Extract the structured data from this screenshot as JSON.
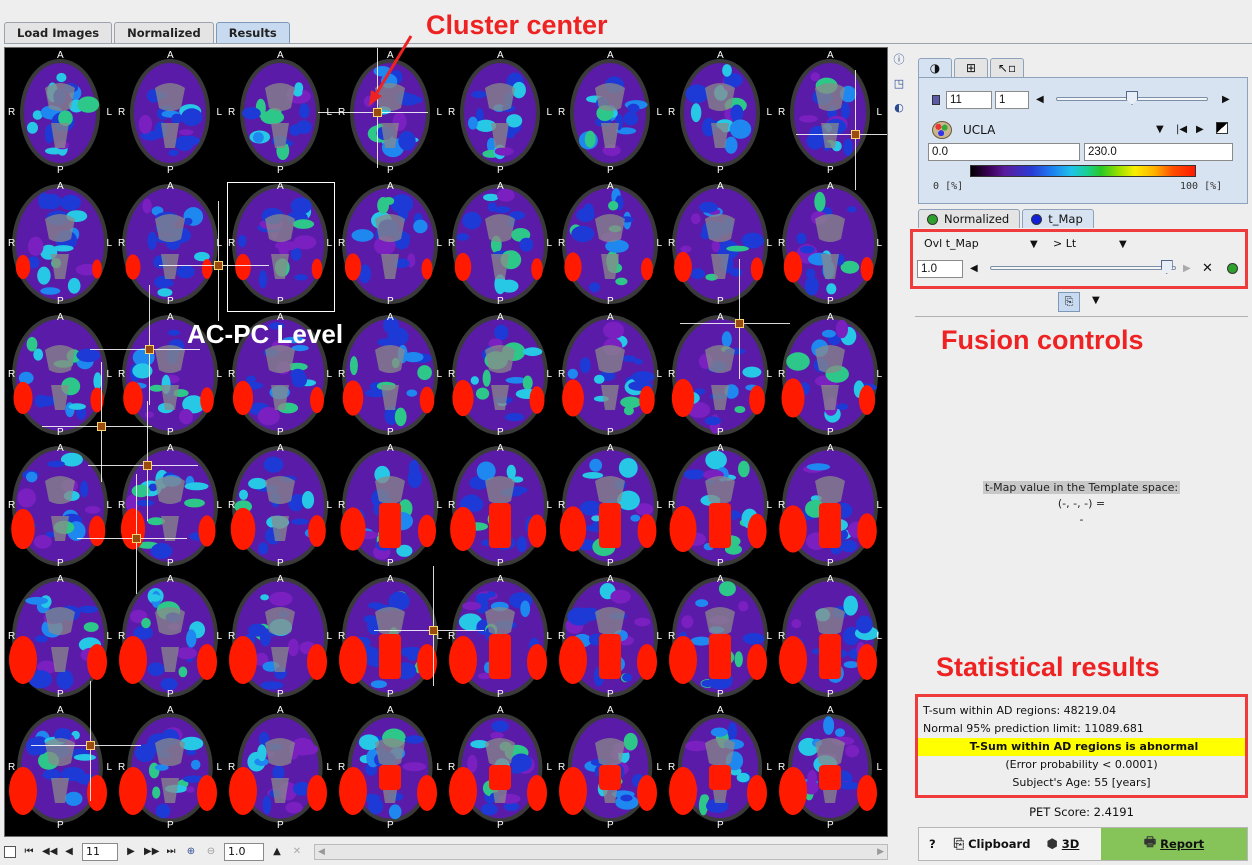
{
  "tabs": [
    {
      "label": "Load Images",
      "active": false
    },
    {
      "label": "Normalized",
      "active": false
    },
    {
      "label": "Results",
      "active": true
    }
  ],
  "orientation": {
    "anterior": "A",
    "posterior": "P",
    "right": "R",
    "left": "L"
  },
  "annotations": {
    "cluster_center": "Cluster center",
    "acpc": "AC-PC Level",
    "fusion": "Fusion controls",
    "stats": "Statistical results"
  },
  "nav": {
    "slice": "11",
    "zoom": "1.0"
  },
  "color_panel": {
    "tab_icons": [
      "contrast-icon",
      "layout-icon",
      "pointer-icon"
    ],
    "slice_a": "11",
    "slice_b": "1",
    "slider_fraction": 0.5,
    "lut_name": "UCLA",
    "min": "0.0",
    "max": "230.0",
    "scale_min": "0",
    "scale_max": "100",
    "unit": "[%]"
  },
  "series_tabs": [
    {
      "label": "Normalized",
      "color": "#2ea02e",
      "active": false
    },
    {
      "label": "t_Map",
      "color": "#1020d8",
      "active": true
    }
  ],
  "fusion": {
    "ovl_label": "Ovl",
    "ovl_value": "t_Map",
    "threshold_mode": "> Lt",
    "value": "1.0",
    "slider_fraction": 0.95
  },
  "probe": {
    "title": "t-Map value in the Template space:",
    "coords": "(-, -, -) =",
    "value": "-"
  },
  "stats": {
    "line1": "T-sum within AD regions: 48219.04",
    "line2": "Normal 95% prediction limit: 11089.681",
    "verdict": "T-Sum within AD regions is abnormal",
    "error": "(Error probability < 0.0001)",
    "age": "Subject's Age: 55 [years]"
  },
  "pet_score": "PET Score: 2.4191",
  "buttons": {
    "help": "?",
    "clipboard": "Clipboard",
    "threed": "3D",
    "report": "Report"
  },
  "colors": {
    "accent_red": "#ef3b3b",
    "tab_active": "#c8daf0",
    "report_green": "#86c45a",
    "verdict_yellow": "#ffff00"
  }
}
